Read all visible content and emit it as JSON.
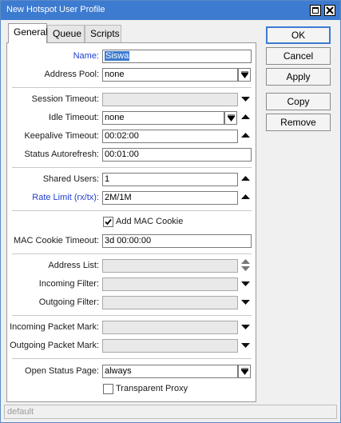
{
  "window": {
    "title": "New Hotspot User Profile"
  },
  "tabs": [
    "General",
    "Queue",
    "Scripts"
  ],
  "form": {
    "name": {
      "label": "Name:",
      "value": "Siswa"
    },
    "address_pool": {
      "label": "Address Pool:",
      "value": "none"
    },
    "session_timeout": {
      "label": "Session Timeout:",
      "value": ""
    },
    "idle_timeout": {
      "label": "Idle Timeout:",
      "value": "none"
    },
    "keepalive_timeout": {
      "label": "Keepalive Timeout:",
      "value": "00:02:00"
    },
    "status_autorefresh": {
      "label": "Status Autorefresh:",
      "value": "00:01:00"
    },
    "shared_users": {
      "label": "Shared Users:",
      "value": "1"
    },
    "rate_limit": {
      "label": "Rate Limit (rx/tx):",
      "value": "2M/1M"
    },
    "add_mac_cookie": {
      "label": "Add MAC Cookie",
      "checked": true
    },
    "mac_cookie_timeout": {
      "label": "MAC Cookie Timeout:",
      "value": "3d 00:00:00"
    },
    "address_list": {
      "label": "Address List:",
      "value": ""
    },
    "incoming_filter": {
      "label": "Incoming Filter:",
      "value": ""
    },
    "outgoing_filter": {
      "label": "Outgoing Filter:",
      "value": ""
    },
    "incoming_packet_mark": {
      "label": "Incoming Packet Mark:",
      "value": ""
    },
    "outgoing_packet_mark": {
      "label": "Outgoing Packet Mark:",
      "value": ""
    },
    "open_status_page": {
      "label": "Open Status Page:",
      "value": "always"
    },
    "transparent_proxy": {
      "label": "Transparent Proxy",
      "checked": false
    }
  },
  "buttons": {
    "ok": "OK",
    "cancel": "Cancel",
    "apply": "Apply",
    "copy": "Copy",
    "remove": "Remove"
  },
  "status": "default",
  "colors": {
    "titlebar": "#3d7bd0",
    "label_highlight": "#1f3fd0",
    "selection": "#3d7bd0"
  }
}
